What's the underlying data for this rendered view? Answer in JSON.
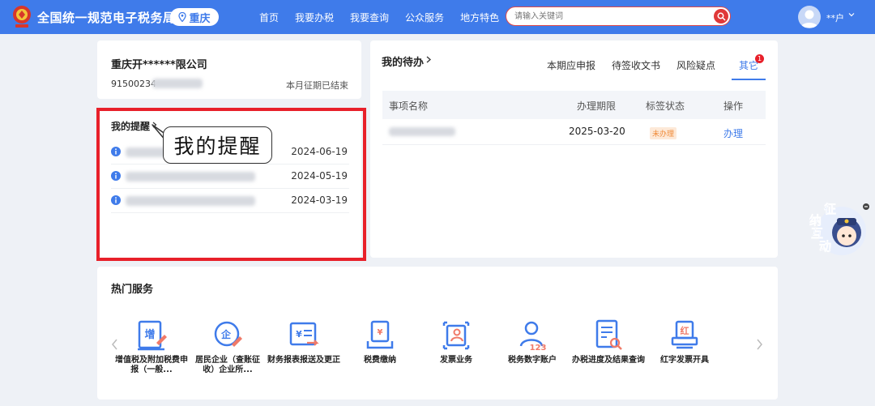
{
  "header": {
    "site_title": "全国统一规范电子税务局",
    "city": "重庆",
    "nav": [
      "首页",
      "我要办税",
      "我要查询",
      "公众服务",
      "地方特色"
    ],
    "search_placeholder": "请输入关键词",
    "user_name": "**户"
  },
  "company": {
    "name": "重庆开******限公司",
    "tax_id_prefix": "91500234",
    "period_status": "本月征期已结束"
  },
  "reminders": {
    "title": "我的提醒",
    "callout": "我的提醒",
    "items": [
      {
        "date": "2024-06-19"
      },
      {
        "date": "2024-05-19"
      },
      {
        "date": "2024-03-19"
      }
    ]
  },
  "todo": {
    "title": "我的待办",
    "tabs": [
      "本期应申报",
      "待签收文书",
      "风险疑点",
      "其它"
    ],
    "active_tab": "其它",
    "badge": "1",
    "columns": [
      "事项名称",
      "办理期限",
      "标签状态",
      "操作"
    ],
    "rows": [
      {
        "deadline": "2025-03-20",
        "status": "未办理",
        "action": "办理"
      }
    ]
  },
  "services": {
    "title": "热门服务",
    "items": [
      {
        "label": "增值税及附加税费申报（一般...",
        "icon": "vat-return-icon"
      },
      {
        "label": "居民企业（查账征收）企业所...",
        "icon": "enterprise-tax-icon"
      },
      {
        "label": "财务报表报送及更正",
        "icon": "financial-report-icon"
      },
      {
        "label": "税费缴纳",
        "icon": "tax-payment-icon"
      },
      {
        "label": "发票业务",
        "icon": "invoice-business-icon"
      },
      {
        "label": "税务数字账户",
        "icon": "digital-account-icon"
      },
      {
        "label": "办税进度及结果查询",
        "icon": "progress-query-icon"
      },
      {
        "label": "红字发票开具",
        "icon": "red-invoice-icon"
      }
    ]
  },
  "chat_bot": {
    "text": "征纳互动"
  },
  "colors": {
    "primary": "#3f7bea",
    "highlight": "#e8202a",
    "status": "#f08b3a"
  }
}
